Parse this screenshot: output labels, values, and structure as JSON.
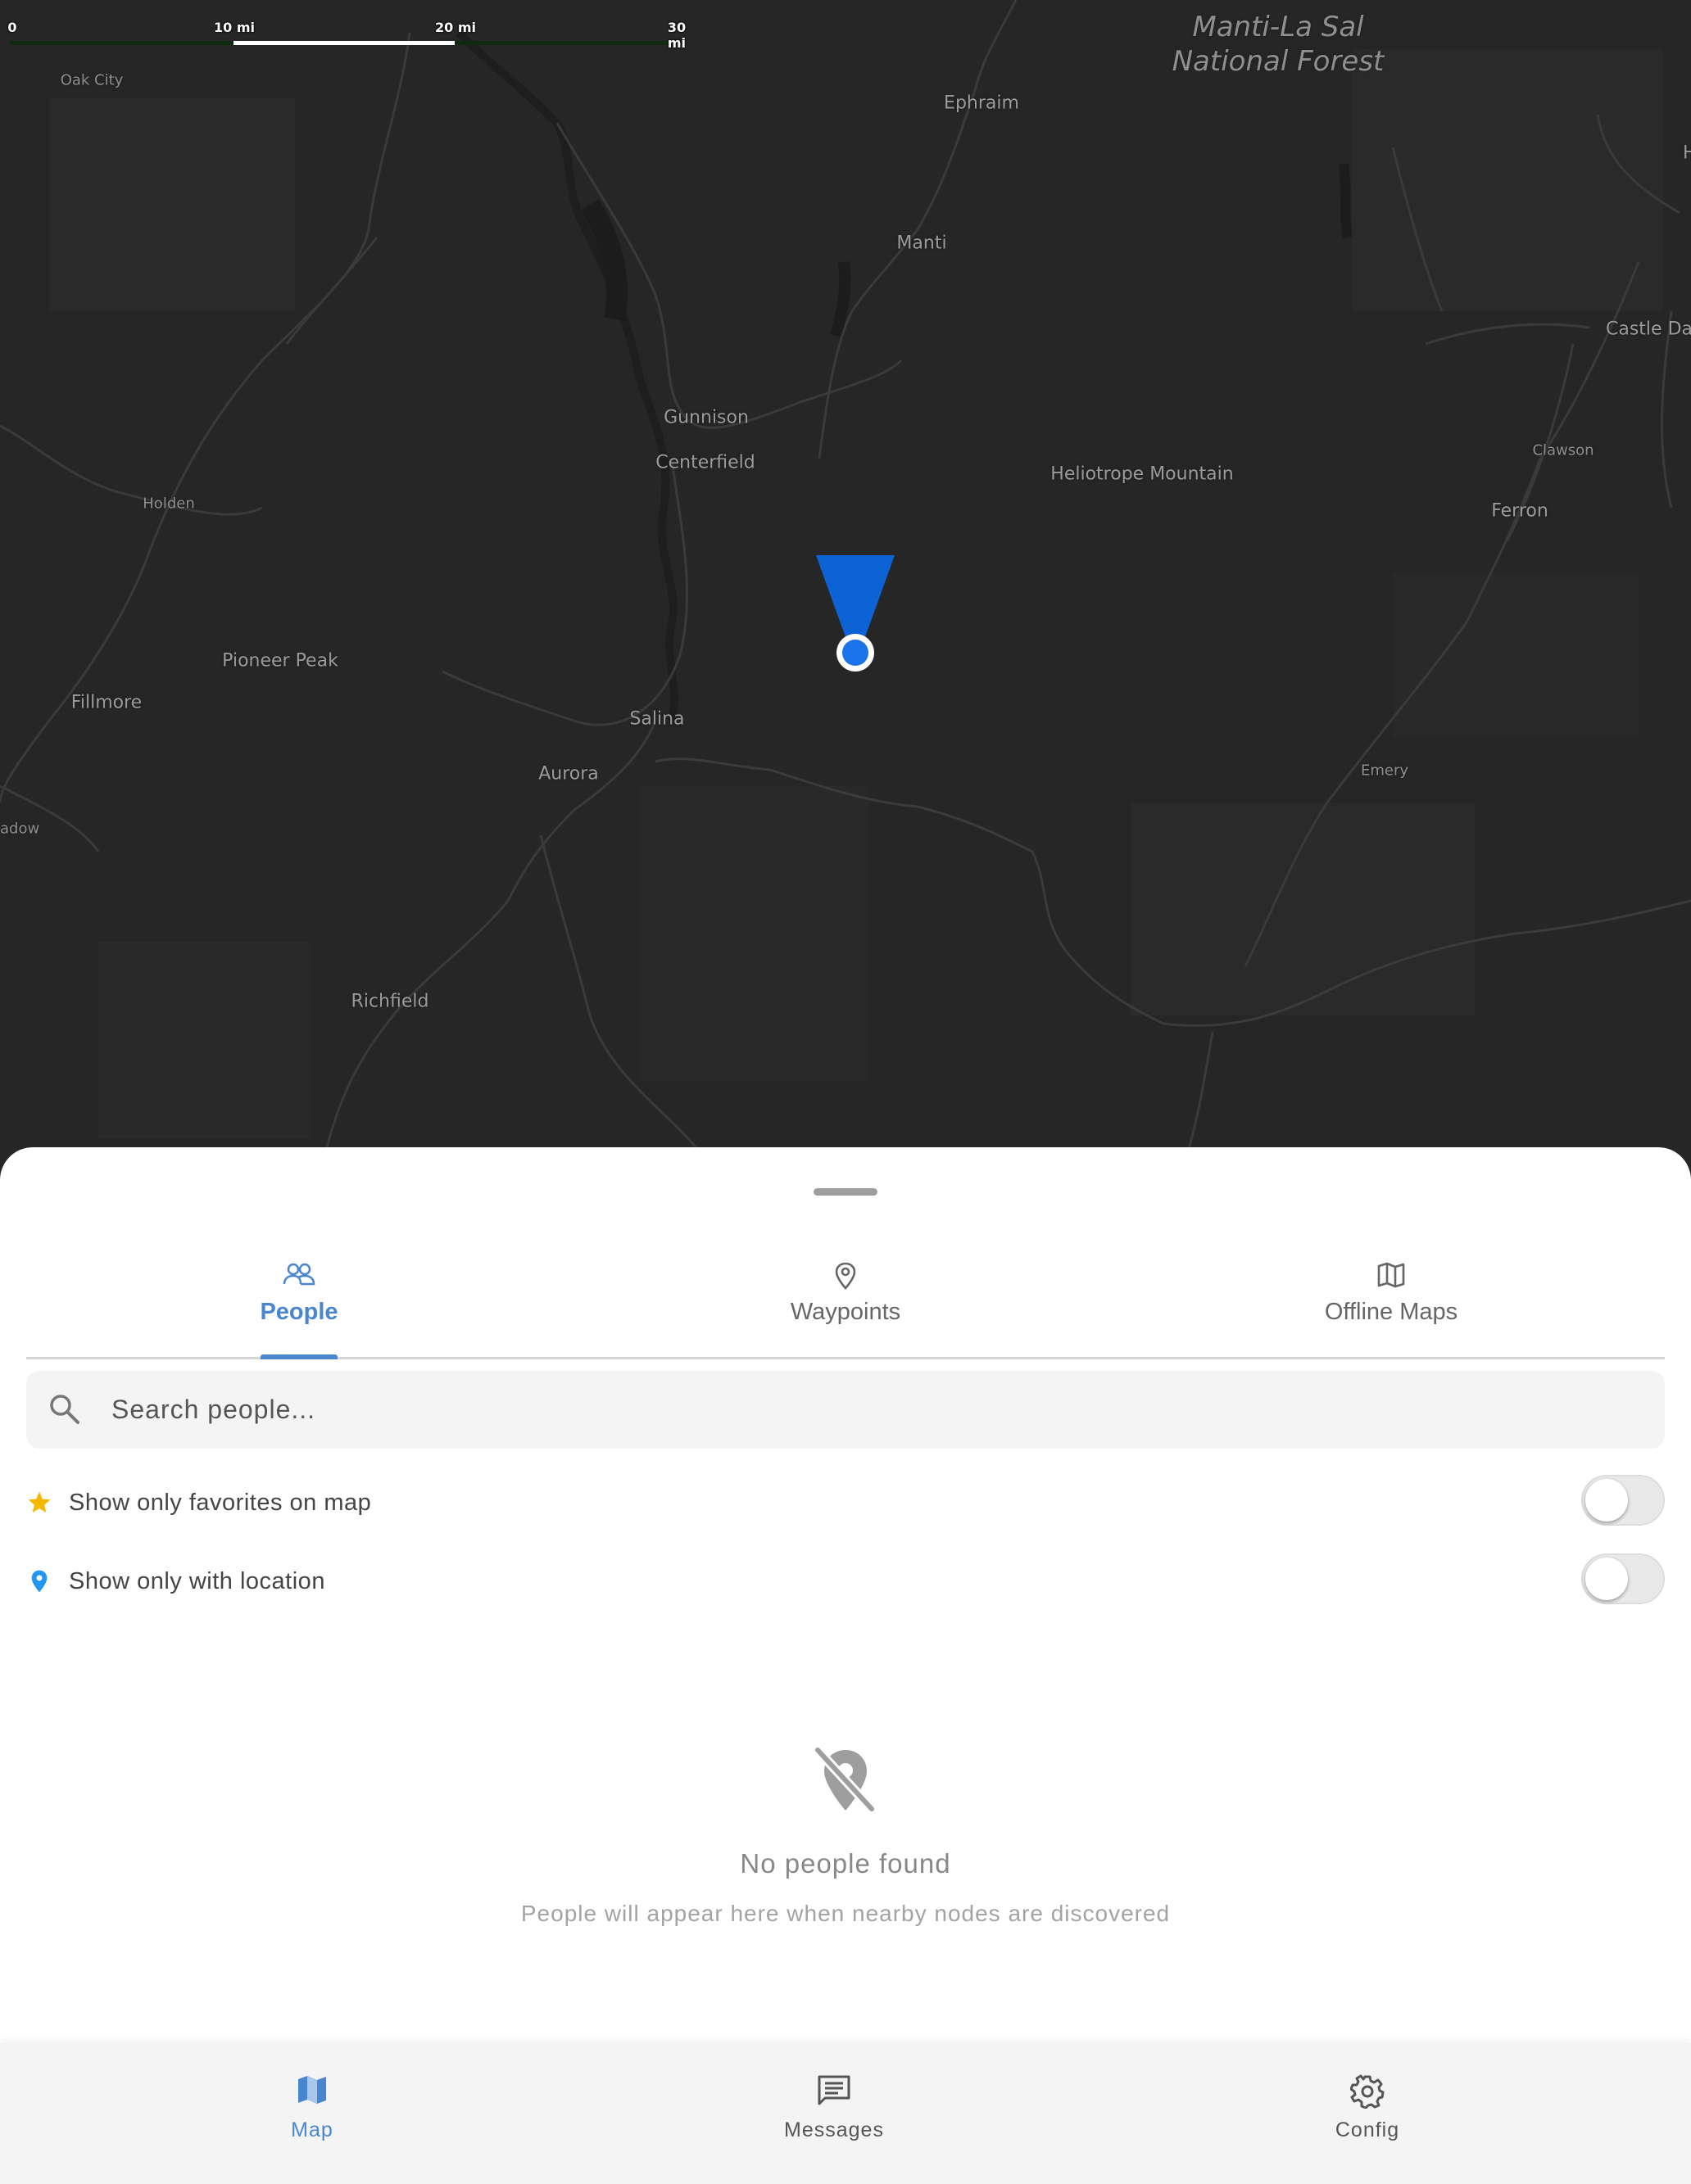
{
  "map": {
    "scale_bar": {
      "ticks": [
        "0",
        "10 mi",
        "20 mi",
        "30 mi"
      ]
    },
    "forest_label": {
      "line1": "Manti-La Sal",
      "line2": "National Forest"
    },
    "places": {
      "oak_city": "Oak City",
      "ephraim": "Ephraim",
      "hu": "Hu",
      "manti": "Manti",
      "castle_dale": "Castle Da",
      "gunnison": "Gunnison",
      "centerfield": "Centerfield",
      "heliotrope": "Heliotrope Mountain",
      "clawson": "Clawson",
      "holden": "Holden",
      "ferron": "Ferron",
      "pioneer_peak": "Pioneer Peak",
      "fillmore": "Fillmore",
      "salina": "Salina",
      "aurora": "Aurora",
      "emery": "Emery",
      "meadow": "adow",
      "richfield": "Richfield"
    },
    "location_color": "#1a73e8",
    "heading_color": "#0d63d4"
  },
  "sheet": {
    "tabs": [
      {
        "label": "People",
        "icon": "people-icon",
        "active": true
      },
      {
        "label": "Waypoints",
        "icon": "waypoint-icon",
        "active": false
      },
      {
        "label": "Offline Maps",
        "icon": "map-icon",
        "active": false
      }
    ],
    "search": {
      "placeholder": "Search people..."
    },
    "filters": {
      "favorites_label": "Show only favorites on map",
      "location_label": "Show only with location"
    },
    "empty": {
      "title": "No people found",
      "subtitle": "People will appear here when nearby nodes are discovered"
    },
    "accent_color": "#4a86d0"
  },
  "nav": {
    "items": [
      {
        "label": "Map",
        "icon": "map-icon",
        "active": true
      },
      {
        "label": "Messages",
        "icon": "messages-icon",
        "active": false
      },
      {
        "label": "Config",
        "icon": "gear-icon",
        "active": false
      }
    ]
  }
}
